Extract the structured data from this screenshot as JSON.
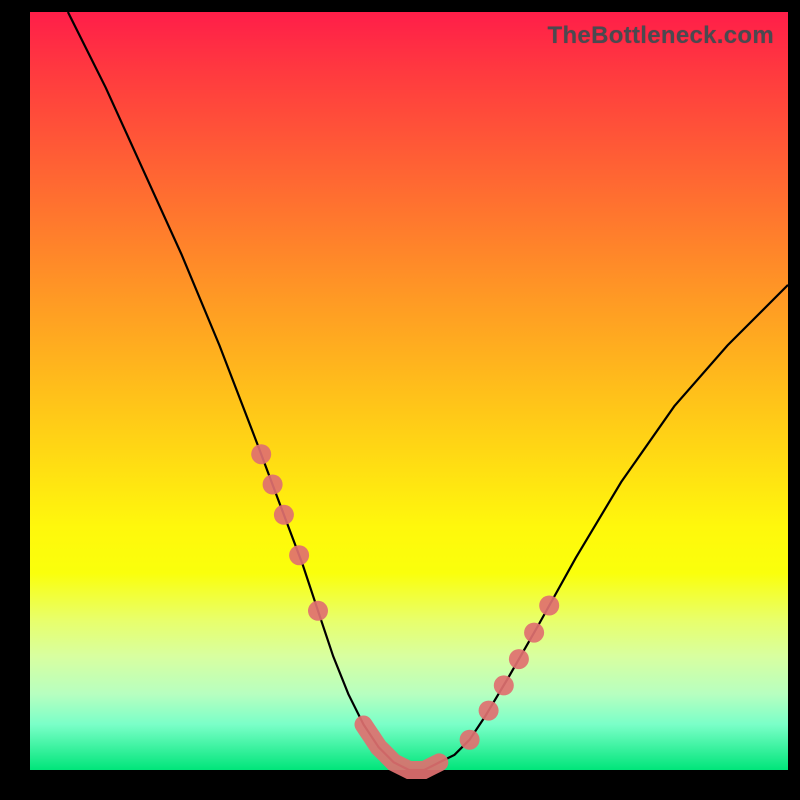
{
  "watermark": "TheBottleneck.com",
  "colors": {
    "bead": "#e07070",
    "curve": "#000000",
    "frame": "#000000"
  },
  "chart_data": {
    "type": "line",
    "title": "",
    "xlabel": "",
    "ylabel": "",
    "xlim": [
      0,
      100
    ],
    "ylim": [
      0,
      100
    ],
    "grid": false,
    "legend": false,
    "series": [
      {
        "name": "bottleneck-curve",
        "x": [
          5,
          10,
          15,
          20,
          25,
          30,
          33,
          36,
          38,
          40,
          42,
          44,
          46,
          48,
          50,
          52,
          54,
          56,
          58,
          60,
          63,
          67,
          72,
          78,
          85,
          92,
          100
        ],
        "y": [
          100,
          90,
          79,
          68,
          56,
          43,
          35,
          27,
          21,
          15,
          10,
          6,
          3,
          1,
          0,
          0,
          1,
          2,
          4,
          7,
          12,
          19,
          28,
          38,
          48,
          56,
          64
        ]
      }
    ],
    "markers": {
      "left_beads_x": [
        30.5,
        32.0,
        33.5,
        35.5,
        38.0
      ],
      "right_beads_x": [
        58.0,
        60.5,
        62.5,
        64.5,
        66.5,
        68.5
      ],
      "bottom_band_x": [
        44.0,
        54.0
      ]
    },
    "notes": "Background is a vertical red→yellow→green gradient. Curve is an asymmetric V with minimum near x≈50. Pink beads cluster on both arms near the bottom and a continuous pink band sits along the minimum."
  }
}
